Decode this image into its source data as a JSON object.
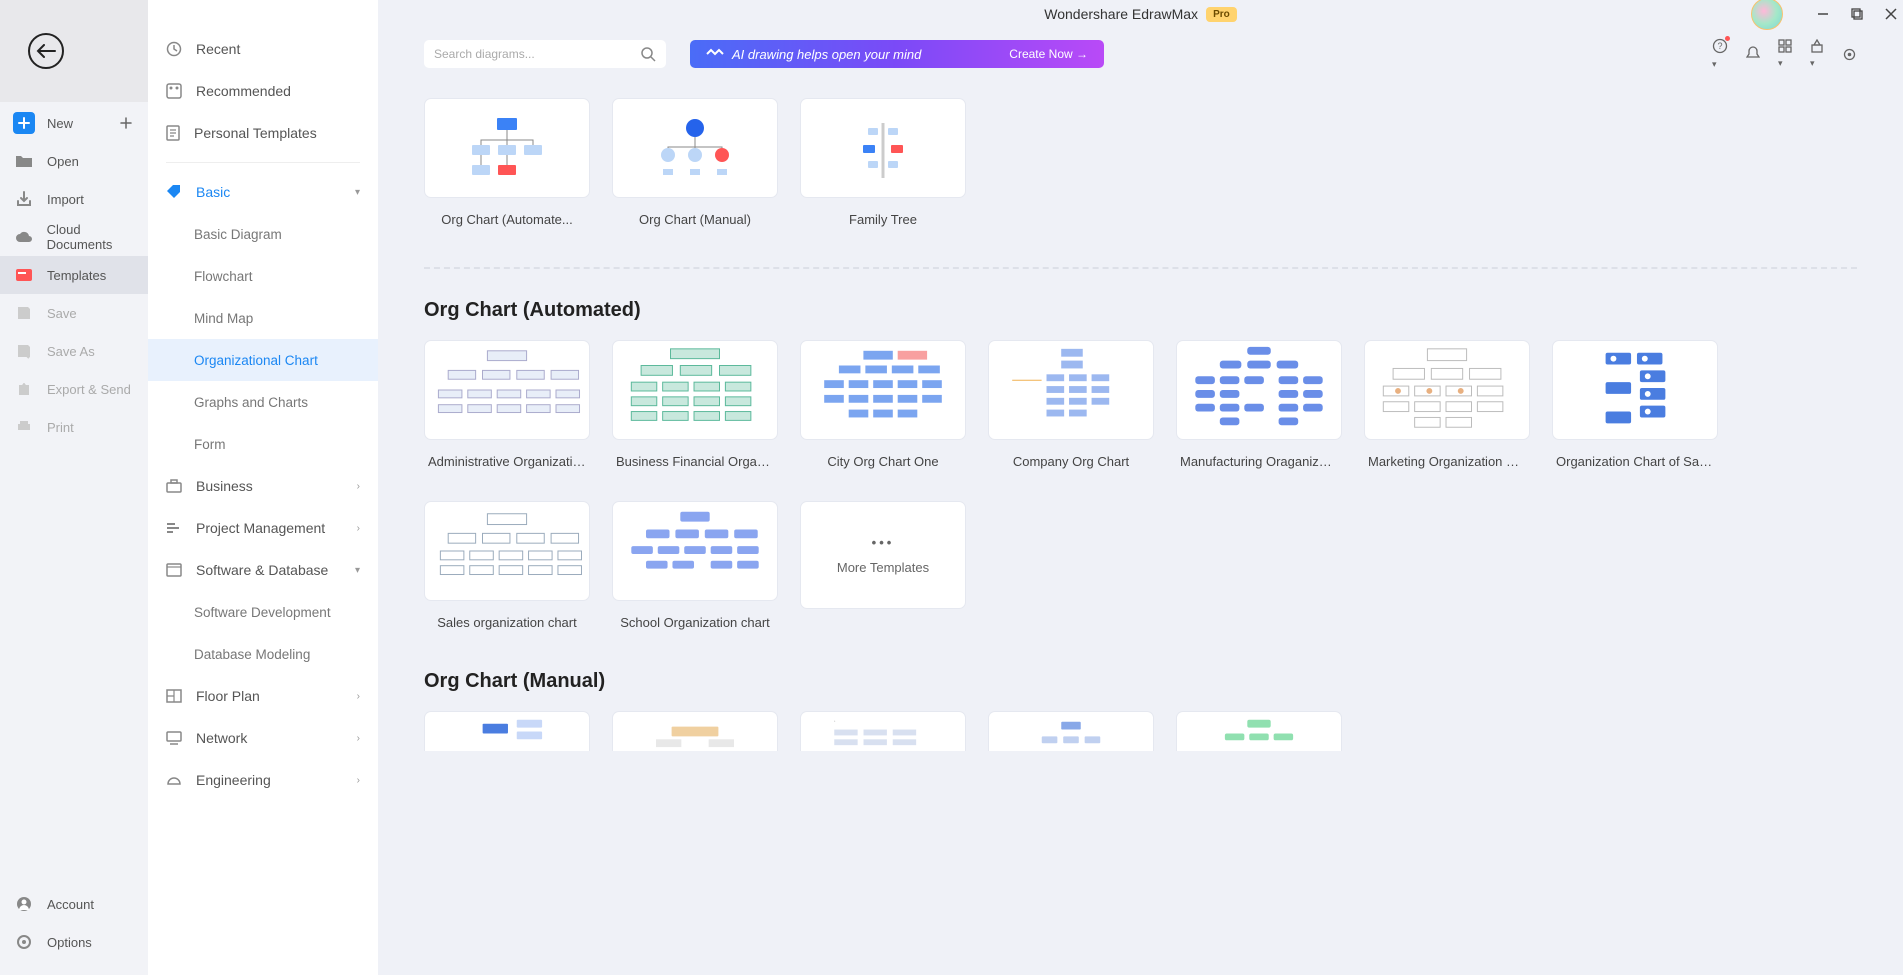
{
  "app": {
    "title": "Wondershare EdrawMax",
    "badge": "Pro"
  },
  "sidebar": {
    "items": [
      {
        "label": "New"
      },
      {
        "label": "Open"
      },
      {
        "label": "Import"
      },
      {
        "label": "Cloud Documents"
      },
      {
        "label": "Templates"
      },
      {
        "label": "Save"
      },
      {
        "label": "Save As"
      },
      {
        "label": "Export & Send"
      },
      {
        "label": "Print"
      }
    ],
    "bottom": [
      {
        "label": "Account"
      },
      {
        "label": "Options"
      }
    ]
  },
  "categories": {
    "top": [
      {
        "label": "Recent"
      },
      {
        "label": "Recommended"
      },
      {
        "label": "Personal Templates"
      }
    ],
    "basic": {
      "label": "Basic"
    },
    "basic_subs": [
      {
        "label": "Basic Diagram"
      },
      {
        "label": "Flowchart"
      },
      {
        "label": "Mind Map"
      },
      {
        "label": "Organizational Chart"
      },
      {
        "label": "Graphs and Charts"
      },
      {
        "label": "Form"
      }
    ],
    "others": [
      {
        "label": "Business"
      },
      {
        "label": "Project Management"
      },
      {
        "label": "Software & Database"
      }
    ],
    "swdb_subs": [
      {
        "label": "Software Development"
      },
      {
        "label": "Database Modeling"
      }
    ],
    "more_others": [
      {
        "label": "Floor Plan"
      },
      {
        "label": "Network"
      },
      {
        "label": "Engineering"
      }
    ]
  },
  "search": {
    "placeholder": "Search diagrams..."
  },
  "ai_banner": {
    "text": "AI drawing helps open your mind",
    "cta": "Create Now"
  },
  "blank_templates": [
    {
      "label": "Org Chart (Automate..."
    },
    {
      "label": "Org Chart (Manual)"
    },
    {
      "label": "Family Tree"
    }
  ],
  "section1": {
    "title": "Org Chart (Automated)"
  },
  "section1_items": [
    {
      "label": "Administrative Organizatio..."
    },
    {
      "label": "Business Financial Organiz..."
    },
    {
      "label": "City Org Chart One"
    },
    {
      "label": "Company Org Chart"
    },
    {
      "label": "Manufacturing Oraganizati..."
    },
    {
      "label": "Marketing Organization Ch..."
    },
    {
      "label": "Organization Chart of Sale..."
    },
    {
      "label": "Sales organization chart"
    },
    {
      "label": "School Organization chart"
    }
  ],
  "more_templates": {
    "label": "More Templates"
  },
  "section2": {
    "title": "Org Chart (Manual)"
  }
}
